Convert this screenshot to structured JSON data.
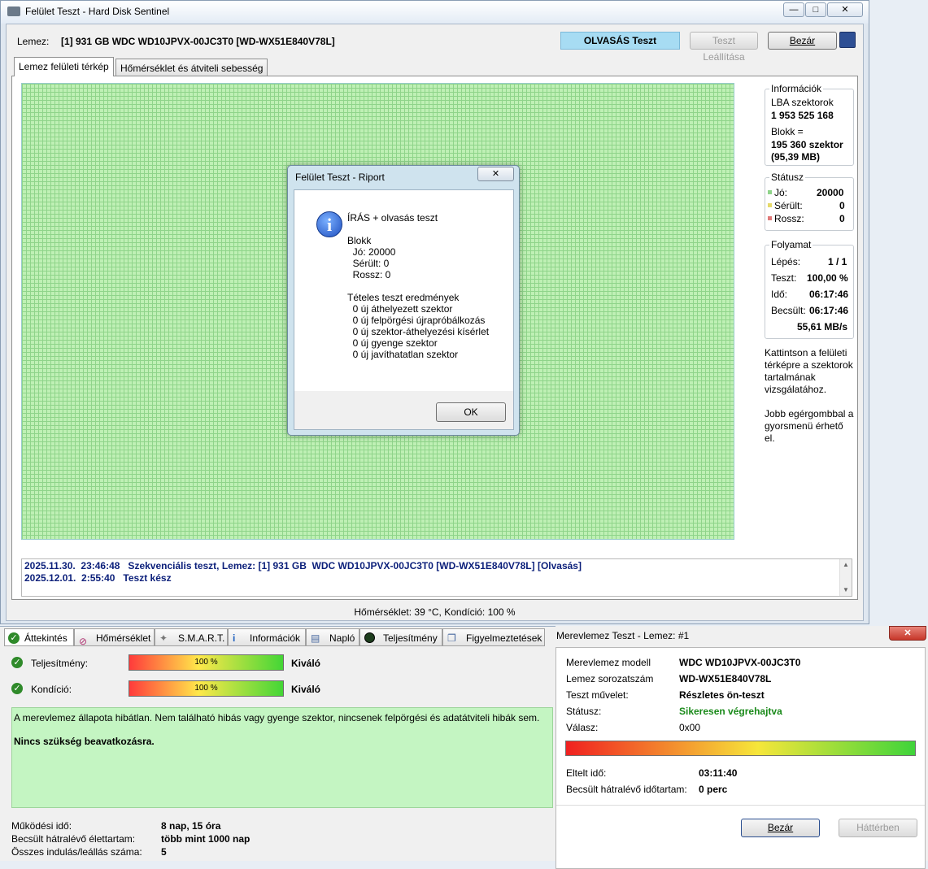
{
  "main": {
    "title": "Felület Teszt - Hard Disk Sentinel",
    "minimize": "—",
    "maximize": "□",
    "close": "✕",
    "disk_label": "Lemez:",
    "disk_name": "[1] 931 GB  WDC WD10JPVX-00JC3T0 [WD-WX51E840V78L]",
    "mode": "OLVASÁS Teszt",
    "stop_button": "Teszt Leállítása",
    "close_button": "Bezár",
    "tabs": [
      "Lemez felületi térkép",
      "Hőmérséklet és átviteli sebesség"
    ],
    "info": {
      "title": "Információk",
      "lba_label": "LBA szektorok",
      "lba_value": "1 953 525 168",
      "block_label": "Blokk =",
      "block_value": "195 360 szektor",
      "block_mb": "(95,39 MB)"
    },
    "status": {
      "title": "Státusz",
      "good_label": "Jó:",
      "good_value": "20000",
      "damaged_label": "Sérült:",
      "damaged_value": "0",
      "bad_label": "Rossz:",
      "bad_value": "0",
      "good_color": "#8fd48a",
      "damaged_color": "#e6d96a",
      "bad_color": "#e07a7a"
    },
    "progress": {
      "title": "Folyamat",
      "step_label": "Lépés:",
      "step_value": "1 / 1",
      "test_label": "Teszt:",
      "test_value": "100,00 %",
      "time_label": "Idő:",
      "time_value": "06:17:46",
      "est_label": "Becsült:",
      "est_value": "06:17:46",
      "speed": "55,61 MB/s"
    },
    "hint1": [
      "Kattintson a felületi",
      "térképre a szektorok",
      "tartalmának",
      "vizsgálatához."
    ],
    "hint2": [
      "Jobb egérgombbal a",
      "gyorsmenü érhető",
      "el."
    ],
    "log": [
      "2025.11.30.  23:46:48   Szekvenciális teszt, Lemez: [1] 931 GB  WDC WD10JPVX-00JC3T0 [WD-WX51E840V78L] [Olvasás]",
      "2025.12.01.  2:55:40   Teszt kész"
    ],
    "statusbar": "Hőmérséklet: 39  °C,  Kondíció: 100 %"
  },
  "dialog": {
    "title": "Felület Teszt - Riport",
    "close": "✕",
    "lines": [
      "ÍRÁS + olvasás teszt",
      "",
      "Blokk",
      "  Jó: 20000",
      "  Sérült: 0",
      "  Rossz: 0",
      "",
      "Tételes teszt eredmények",
      "  0 új áthelyezett szektor",
      "  0 új felpörgési újrapróbálkozás",
      "  0 új szektor-áthelyezési kísérlet",
      "  0 új gyenge szektor",
      "  0 új javíthatatlan szektor"
    ],
    "ok": "OK"
  },
  "bottom": {
    "tabs": [
      "Áttekintés",
      "Hőmérséklet",
      "S.M.A.R.T.",
      "Információk",
      "Napló",
      "Teljesítmény",
      "Figyelmeztetések"
    ],
    "performance_label": "Teljesítmény:",
    "performance_value": "100 %",
    "performance_level": 100,
    "performance_rating": "Kiváló",
    "condition_label": "Kondíció:",
    "condition_value": "100 %",
    "condition_level": 100,
    "condition_rating": "Kiváló",
    "summary": "A merevlemez állapota hibátlan. Nem található hibás vagy gyenge szektor, nincsenek felpörgési és adatátviteli hibák sem.",
    "summary_action": "Nincs szükség beavatkozásra.",
    "uptime_label": "Működési idő:",
    "uptime_value": "8 nap, 15 óra",
    "life_label": "Becsült hátralévő élettartam:",
    "life_value": "több mint 1000 nap",
    "starts_label": "Összes indulás/leállás száma:",
    "starts_value": "5"
  },
  "hdd_test": {
    "title": "Merevlemez Teszt - Lemez: #1",
    "close": "✕",
    "model_label": "Merevlemez modell",
    "model_value": "WDC WD10JPVX-00JC3T0",
    "serial_label": "Lemez sorozatszám",
    "serial_value": "WD-WX51E840V78L",
    "op_label": "Teszt művelet:",
    "op_value": "Részletes ön-teszt",
    "status_label": "Státusz:",
    "status_value": "Sikeresen végrehajtva",
    "status_color": "#1a8a1a",
    "response_label": "Válasz:",
    "response_value": "0x00",
    "progress_level": 100,
    "elapsed_label": "Eltelt idő:",
    "elapsed_value": "03:11:40",
    "remaining_label": "Becsült hátralévő időtartam:",
    "remaining_value": "0 perc",
    "close_button": "Bezár",
    "background_button": "Háttérben"
  }
}
